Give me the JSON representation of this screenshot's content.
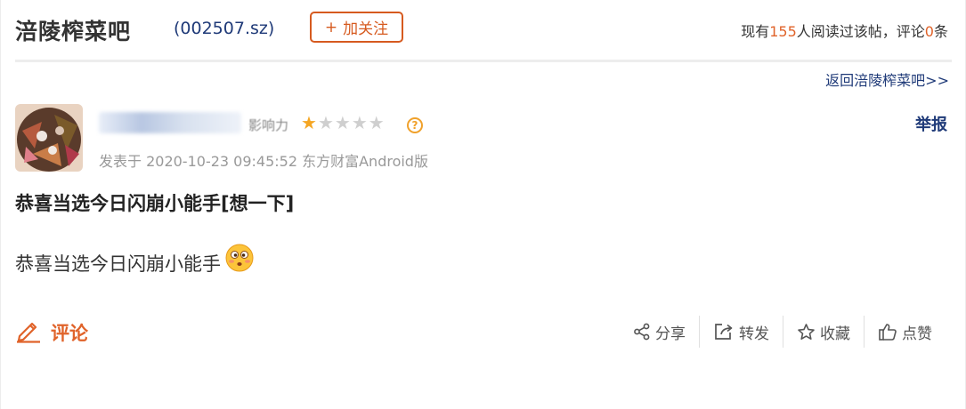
{
  "header": {
    "bar_name": "涪陵榨菜吧",
    "stock_code": "(002507.sz)",
    "follow_label": "加关注",
    "follow_plus": "+",
    "read_prefix": "现有",
    "read_count": "155",
    "read_middle": "人阅读过该帖，评论",
    "comment_count": "0",
    "read_suffix": "条"
  },
  "nav": {
    "back_link": "返回涪陵榨菜吧>>"
  },
  "post": {
    "user_level": "影响力",
    "stars": {
      "filled": 1,
      "total": 5
    },
    "help_glyph": "?",
    "meta": "发表于 2020-10-23 09:45:52 东方财富Android版",
    "report_label": "举报",
    "title": "恭喜当选今日闪崩小能手[想一下]",
    "body": "恭喜当选今日闪崩小能手"
  },
  "footer": {
    "comment_label": "评论",
    "share_label": "分享",
    "forward_label": "转发",
    "favorite_label": "收藏",
    "like_label": "点赞"
  },
  "colors": {
    "accent": "#e0632a",
    "link": "#1f3a78",
    "star": "#f5a623"
  },
  "icons": [
    "pencil-icon",
    "share-icon",
    "forward-icon",
    "star-outline-icon",
    "thumbs-up-icon",
    "question-icon",
    "thinking-emoji-icon"
  ]
}
